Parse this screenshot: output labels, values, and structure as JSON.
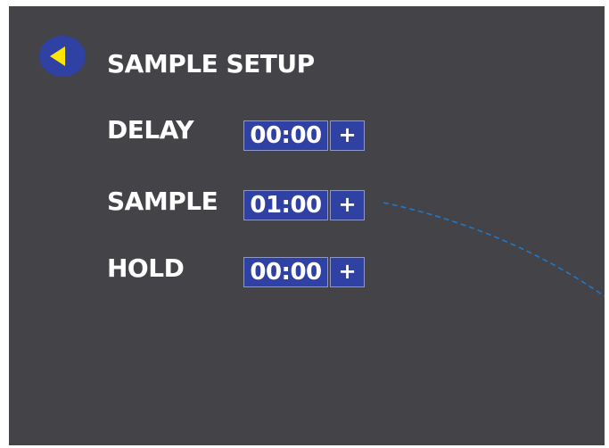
{
  "screen": {
    "title": "SAMPLE SETUP",
    "back_icon": "back-arrow-icon"
  },
  "colors": {
    "background": "#444347",
    "accent": "#2f41a2",
    "back_arrow": "#ffe600",
    "callout_line": "#1f78c8"
  },
  "rows": [
    {
      "label": "DELAY",
      "value": "00:00",
      "increment_label": "+"
    },
    {
      "label": "SAMPLE",
      "value": "01:00",
      "increment_label": "+"
    },
    {
      "label": "HOLD",
      "value": "00:00",
      "increment_label": "+"
    }
  ]
}
